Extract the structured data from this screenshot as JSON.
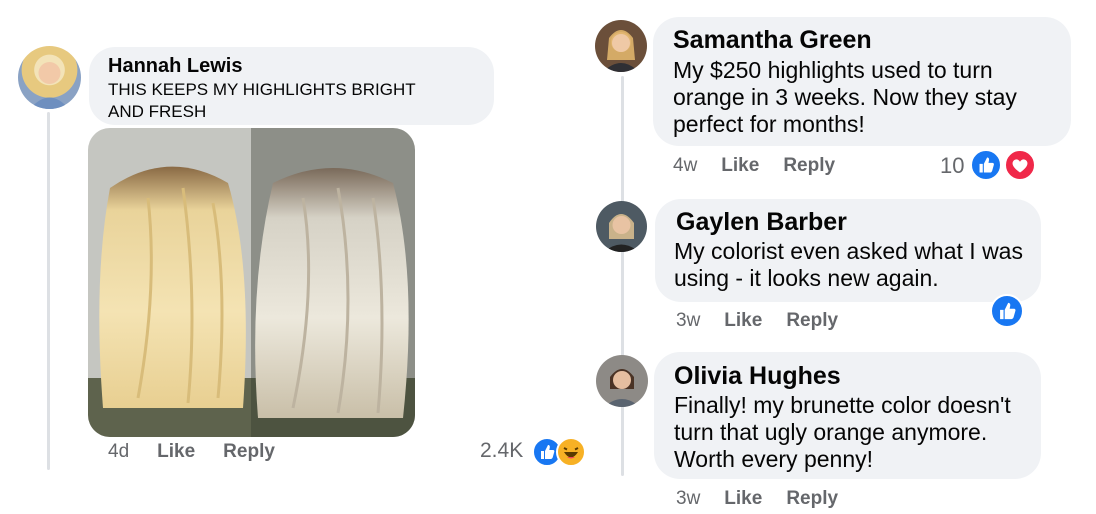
{
  "left_comment": {
    "author": "Hannah Lewis",
    "text_line1": "THIS KEEPS MY HIGHLIGHTS BRIGHT",
    "text_line2": "AND FRESH",
    "time": "4d",
    "like_label": "Like",
    "reply_label": "Reply",
    "reaction_count": "2.4K",
    "reactions": [
      "like-icon",
      "haha-icon"
    ]
  },
  "comments": [
    {
      "author": "Samantha Green",
      "lines": [
        "My $250 highlights used to turn",
        "orange in 3 weeks. Now they stay",
        "perfect for months!"
      ],
      "time": "4w",
      "like_label": "Like",
      "reply_label": "Reply",
      "reaction_count": "10",
      "reactions": [
        "like-icon",
        "love-icon"
      ]
    },
    {
      "author": "Gaylen Barber",
      "lines": [
        "My colorist even asked what I was",
        "using - it looks new again."
      ],
      "time": "3w",
      "like_label": "Like",
      "reply_label": "Reply",
      "reactions": [
        "like-icon"
      ]
    },
    {
      "author": "Olivia Hughes",
      "lines": [
        "Finally! my brunette color doesn't",
        "turn that ugly orange anymore.",
        "Worth every penny!"
      ],
      "time": "3w",
      "like_label": "Like",
      "reply_label": "Reply"
    }
  ],
  "colors": {
    "bubble": "#f0f2f5",
    "meta_text": "#65676b",
    "like_blue": "#1877f2",
    "love_red": "#f02849",
    "haha_yellow": "#f7b125"
  }
}
